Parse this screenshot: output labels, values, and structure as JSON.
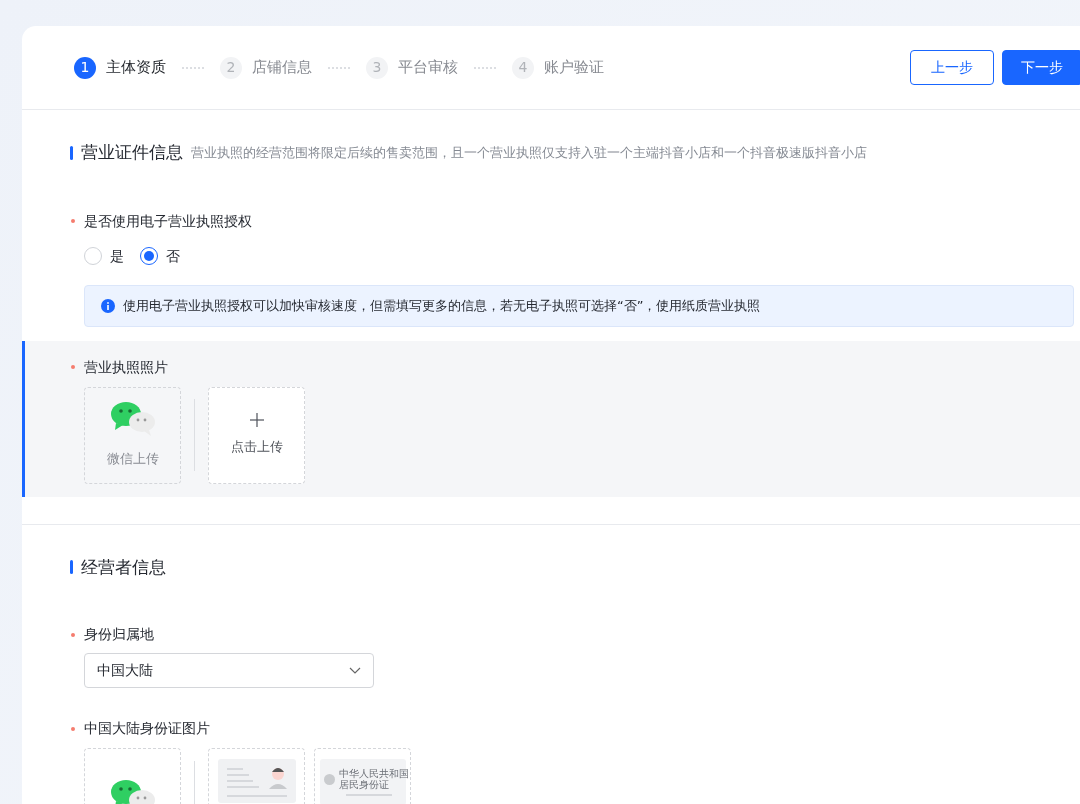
{
  "steps": [
    {
      "number": "1",
      "label": "主体资质",
      "selected": true
    },
    {
      "number": "2",
      "label": "店铺信息",
      "selected": false
    },
    {
      "number": "3",
      "label": "平台审核",
      "selected": false
    },
    {
      "number": "4",
      "label": "账户验证",
      "selected": false
    }
  ],
  "buttons": [
    {
      "label": "上一步",
      "kind": "outline"
    },
    {
      "label": "下一步",
      "kind": "primary"
    }
  ],
  "sections": [
    {
      "title": "营业证件信息",
      "subtitle": "营业执照的经营范围将限定后续的售卖范围，且一个营业执照仅支持入驻一个主端抖音小店和一个抖音极速版抖音小店",
      "fields": [
        {
          "kind": "radio",
          "label": "是否使用电子营业执照授权",
          "required": true,
          "options": [
            {
              "label": "是",
              "selected": false
            },
            {
              "label": "否",
              "selected": true
            }
          ]
        },
        {
          "kind": "alert",
          "text": "使用电子营业执照授权可以加快审核速度，但需填写更多的信息，若无电子执照可选择“否”，使用纸质营业执照"
        },
        {
          "kind": "upload",
          "label": "营业执照照片",
          "required": true,
          "highlighted": true,
          "tiles": [
            {
              "kind": "wechat",
              "label": "微信上传"
            },
            {
              "kind": "plus",
              "label": "点击上传"
            }
          ]
        }
      ]
    },
    {
      "title": "经营者信息",
      "fields": [
        {
          "kind": "select",
          "label": "身份归属地",
          "required": true,
          "value": "中国大陆"
        },
        {
          "kind": "upload",
          "label": "中国大陆身份证图片",
          "required": true,
          "highlighted": false,
          "tiles": [
            {
              "kind": "wechat"
            },
            {
              "kind": "id-front"
            },
            {
              "kind": "id-back",
              "line_1": "中华人民共和国",
              "line_2": "居民身份证"
            }
          ]
        }
      ]
    }
  ]
}
